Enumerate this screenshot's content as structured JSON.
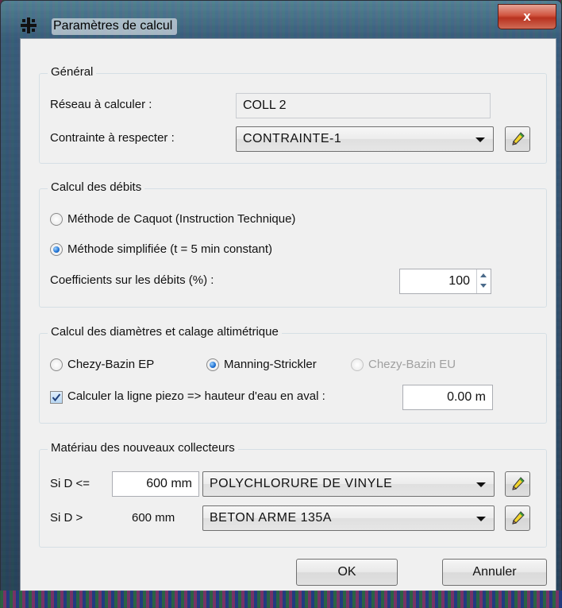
{
  "window": {
    "title": "Paramètres de calcul",
    "close_label": "x"
  },
  "general": {
    "legend": "Général",
    "network_label": "Réseau à calculer :",
    "network_value": "COLL 2",
    "constraint_label": "Contrainte à respecter :",
    "constraint_value": "CONTRAINTE-1"
  },
  "flows": {
    "legend": "Calcul des débits",
    "method_caquot": "Méthode de Caquot (Instruction Technique)",
    "method_simplified": "Méthode simplifiée (t = 5 min constant)",
    "selected_method": "simplified",
    "coeff_label": "Coefficients sur les débits (%) :",
    "coeff_value": "100"
  },
  "diameters": {
    "legend": "Calcul des diamètres et calage altimétrique",
    "option_chezy_ep": "Chezy-Bazin EP",
    "option_manning": "Manning-Strickler",
    "option_chezy_eu": "Chezy-Bazin EU",
    "selected_option": "manning",
    "chezy_eu_enabled": false,
    "piezo_label": "Calculer la ligne piezo => hauteur d'eau en aval :",
    "piezo_checked": true,
    "piezo_value": "0.00 m"
  },
  "materials": {
    "legend": "Matériau des nouveaux collecteurs",
    "row1_label": "Si D <=",
    "row1_value": "600 mm",
    "row1_material": "POLYCHLORURE DE VINYLE",
    "row2_label": "Si D >",
    "row2_value": "600 mm",
    "row2_material": "BETON ARME 135A"
  },
  "buttons": {
    "ok": "OK",
    "cancel": "Annuler"
  },
  "icons": {
    "app": "grid-app-icon",
    "edit": "pencil-icon",
    "dropdown": "chevron-down-icon"
  },
  "colors": {
    "accent": "#1c6fd1",
    "close_button": "#c8402b"
  }
}
